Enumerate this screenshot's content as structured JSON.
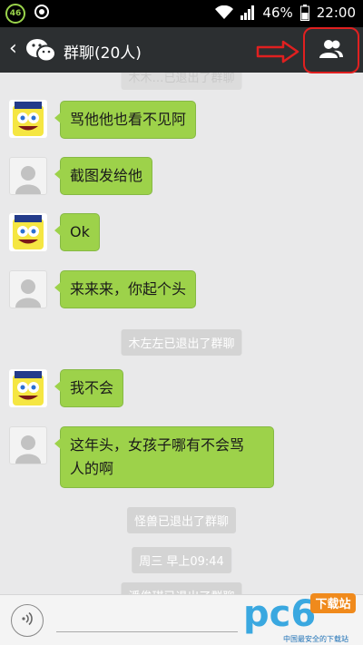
{
  "status_bar": {
    "badge": "46",
    "battery": "46%",
    "time": "22:00"
  },
  "header": {
    "title": "群聊(20人)"
  },
  "messages": {
    "top_partial": "木木…已退出了群聊",
    "m1": "骂他他也看不见阿",
    "m2": "截图发给他",
    "m3": "Ok",
    "m4": "来来来，你起个头",
    "sys1": "木左左已退出了群聊",
    "m5": "我不会",
    "m6_line1": "这年头，女孩子哪有不会骂",
    "m6_line2": "人的啊",
    "sys2": "怪兽已退出了群聊",
    "sys3": "周三 早上09:44",
    "bottom_partial": "潘俊琪已退出了群聊"
  },
  "watermark": {
    "logo": "pc6",
    "badge": "下载站",
    "tagline": "中国最安全的下载站"
  },
  "colors": {
    "bubble": "#9dd24a",
    "header": "#2c2f31",
    "annotation": "#e02020"
  }
}
